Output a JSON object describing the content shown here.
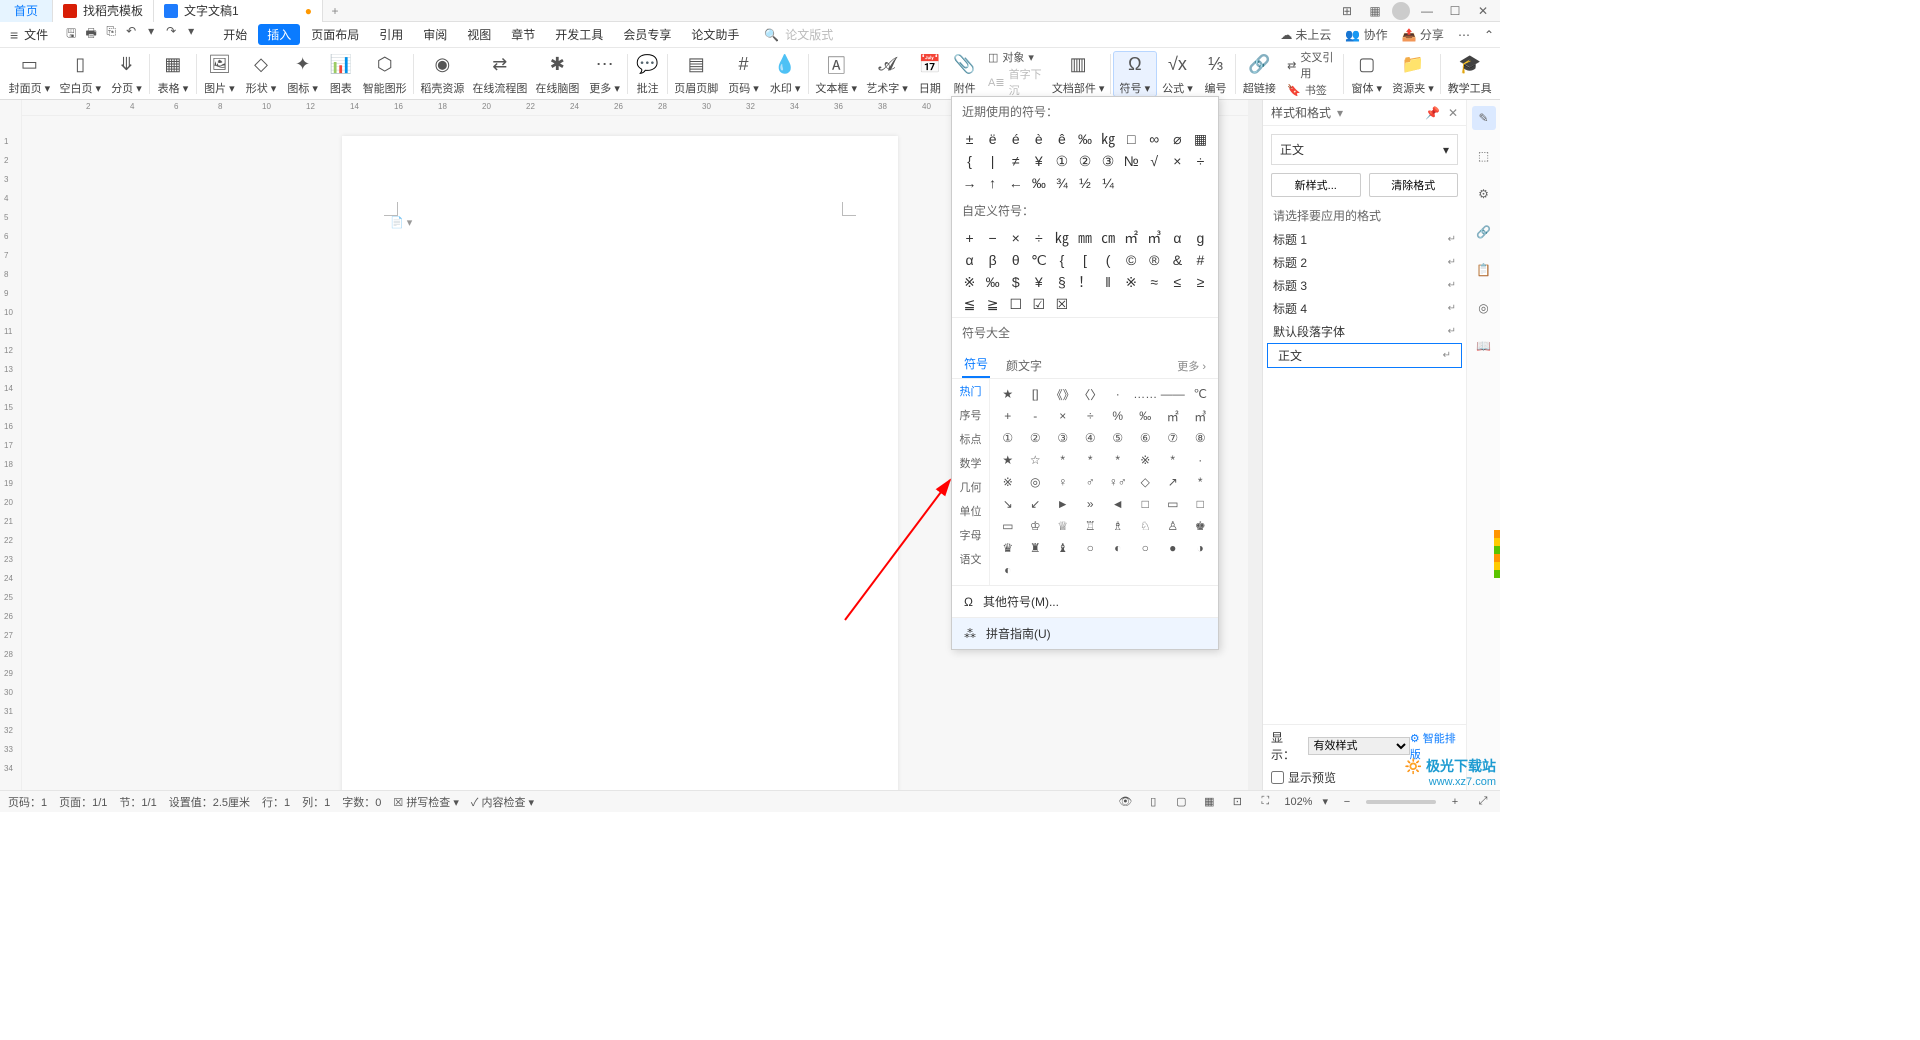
{
  "tabs": {
    "home": "首页",
    "template": "找稻壳模板",
    "doc": "文字文稿1",
    "plus": "+"
  },
  "file_label": "文件",
  "menu": [
    "开始",
    "插入",
    "页面布局",
    "引用",
    "审阅",
    "视图",
    "章节",
    "开发工具",
    "会员专享",
    "论文助手"
  ],
  "search_placeholder": "论文版式",
  "cloud": "未上云",
  "coop": "协作",
  "share": "分享",
  "ribbon": {
    "cover": "封面页",
    "blank": "空白页",
    "pagebreak": "分页",
    "table": "表格",
    "pic": "图片",
    "shape": "形状",
    "icon": "图标",
    "chart": "图表",
    "smart": "智能图形",
    "daoke": "稻壳资源",
    "flow": "在线流程图",
    "mind": "在线脑图",
    "more": "更多",
    "comment": "批注",
    "header": "页眉页脚",
    "pagenum": "页码",
    "watermark": "水印",
    "textbox": "文本框",
    "wordart": "艺术字",
    "date": "日期",
    "attach": "附件",
    "docpart": "文档部件",
    "object": "对象",
    "drop": "首字下沉",
    "symbol": "符号",
    "formula": "公式",
    "number": "编号",
    "link": "超链接",
    "xref": "交叉引用",
    "bookmark": "书签",
    "pane": "窗体",
    "res": "资源夹",
    "teach": "教学工具"
  },
  "sym": {
    "recent": "近期使用的符号：",
    "recent_items": [
      "±",
      "ë",
      "é",
      "è",
      "ê",
      "‰",
      "㎏",
      "□",
      "∞",
      "⌀",
      "▦",
      "{",
      "|",
      "≠",
      "¥",
      "①",
      "②",
      "③",
      "№",
      "√",
      "×",
      "÷",
      "→",
      "↑",
      "←",
      "‰",
      "¾",
      "½",
      "¼"
    ],
    "custom": "自定义符号：",
    "custom_items": [
      "+",
      "−",
      "×",
      "÷",
      "㎏",
      "㎜",
      "㎝",
      "㎡",
      "㎥",
      "α",
      "g",
      "α",
      "β",
      "θ",
      "℃",
      "{",
      "[",
      "(",
      "©",
      "®",
      "&",
      "#",
      "※",
      "‰",
      "$",
      "¥",
      "§",
      "！",
      "‖",
      "※",
      "≈",
      "≤",
      "≥",
      "≦",
      "≧",
      "☐",
      "☑",
      "☒"
    ],
    "library": "符号大全",
    "tab_symbol": "符号",
    "tab_emoji": "颜文字",
    "more": "更多 ›",
    "cats": [
      "热门",
      "序号",
      "标点",
      "数学",
      "几何",
      "单位",
      "字母",
      "语文"
    ],
    "matrix": [
      "★",
      "[]",
      "《》",
      "〈〉",
      "·",
      "……",
      "——",
      "℃",
      "+",
      "-",
      "×",
      "÷",
      "%",
      "‰",
      "㎡",
      "㎥",
      "①",
      "②",
      "③",
      "④",
      "⑤",
      "⑥",
      "⑦",
      "⑧",
      "★",
      "☆",
      "*",
      "*",
      "*",
      "※",
      "*",
      "·",
      "※",
      "◎",
      "♀",
      "♂",
      "♀♂",
      "◇",
      "↗",
      "*",
      "↘",
      "↙",
      "►",
      "»",
      "◄",
      "□",
      "▭",
      "□",
      "▭",
      "♔",
      "♕",
      "♖",
      "♗",
      "♘",
      "♙",
      "♚",
      "♛",
      "♜",
      "♝",
      "○",
      "◐",
      "○",
      "●",
      "◑",
      "◐"
    ],
    "other": "其他符号(M)...",
    "pinyin": "拼音指南(U)"
  },
  "style_pane": {
    "title": "样式和格式",
    "current": "正文",
    "new": "新样式...",
    "clear": "清除格式",
    "hint": "请选择要应用的格式",
    "items": [
      "标题 1",
      "标题 2",
      "标题 3",
      "标题 4",
      "默认段落字体",
      "正文"
    ],
    "show": "显示：",
    "show_val": "有效样式",
    "preview": "显示预览",
    "smart": "智能排版"
  },
  "status": {
    "page": "页码：1",
    "pages": "页面：1/1",
    "section": "节：1/1",
    "indent": "设置值：2.5厘米",
    "line": "行：1",
    "col": "列：1",
    "words": "字数：0",
    "spell": "拼写检查",
    "content": "内容检查",
    "zoom": "102%"
  },
  "watermark": {
    "brand": "极光下载站",
    "url": "www.xz7.com"
  }
}
